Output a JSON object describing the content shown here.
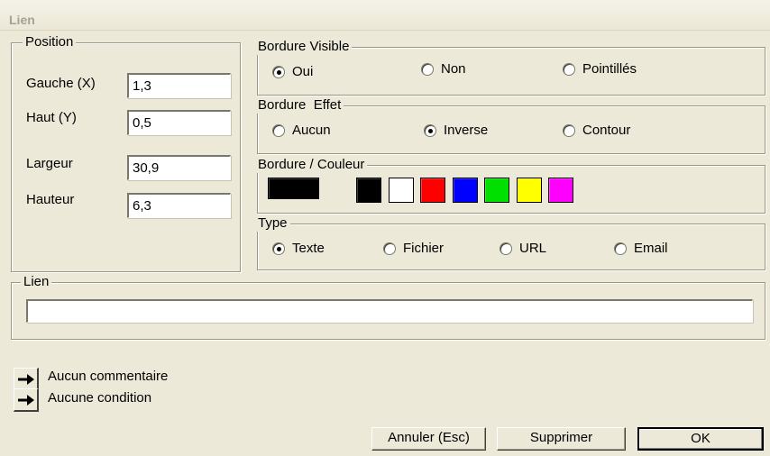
{
  "window": {
    "title": "Lien"
  },
  "position": {
    "legend": "Position",
    "gauche_label": "Gauche (X)",
    "gauche_value": "1,3",
    "haut_label": "Haut (Y)",
    "haut_value": "0,5",
    "largeur_label": "Largeur",
    "largeur_value": "30,9",
    "hauteur_label": "Hauteur",
    "hauteur_value": "6,3"
  },
  "bordure_visible": {
    "legend": "Bordure Visible",
    "options": [
      "Oui",
      "Non",
      "Pointillés"
    ],
    "selected": "Oui"
  },
  "bordure_effet": {
    "legend": "Bordure  Effet",
    "options": [
      "Aucun",
      "Inverse",
      "Contour"
    ],
    "selected": "Inverse"
  },
  "bordure_couleur": {
    "legend": "Bordure / Couleur",
    "current_color": "#000000",
    "palette": [
      "#000000",
      "#ffffff",
      "#ff0000",
      "#0000ff",
      "#00e000",
      "#ffff00",
      "#ff00ff"
    ]
  },
  "type": {
    "legend": "Type",
    "options": [
      "Texte",
      "Fichier",
      "URL",
      "Email"
    ],
    "selected": "Texte"
  },
  "lien": {
    "legend": "Lien",
    "value": ""
  },
  "commentaire": {
    "label": "Aucun commentaire",
    "icon": "arrow-right-icon"
  },
  "condition": {
    "label": "Aucune condition",
    "icon": "arrow-right-icon"
  },
  "buttons": {
    "annuler": "Annuler (Esc)",
    "supprimer": "Supprimer",
    "ok": "OK"
  }
}
